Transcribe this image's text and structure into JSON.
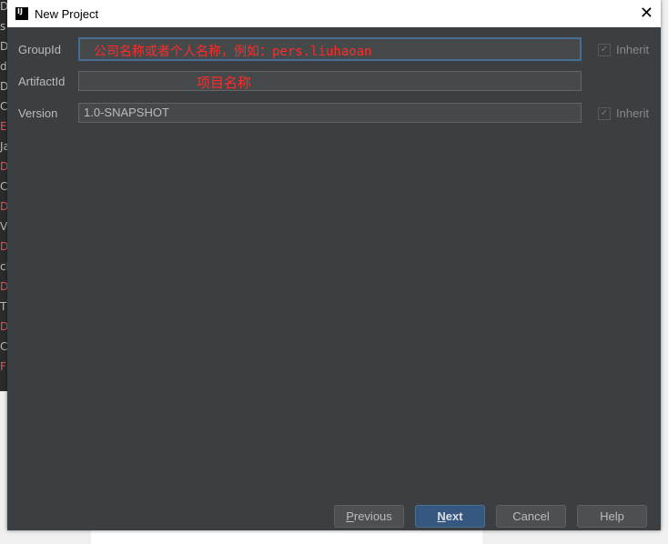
{
  "background": {
    "letters": [
      "D",
      "s",
      "D",
      "d",
      "D",
      "C",
      "E",
      "Ja",
      "D",
      "C",
      "D",
      "V",
      "D",
      "cl",
      "D",
      "T",
      "D",
      "C",
      "F"
    ]
  },
  "dialog": {
    "title": "New Project",
    "fields": [
      {
        "label": "GroupId",
        "value": "",
        "annotation": "公司名称或者个人名称，例如：pers.liuhaoan",
        "inherit": "Inherit",
        "inherit_checked": true
      },
      {
        "label": "ArtifactId",
        "value": "",
        "annotation": "项目名称"
      },
      {
        "label": "Version",
        "value": "1.0-SNAPSHOT",
        "inherit": "Inherit",
        "inherit_checked": true
      }
    ],
    "buttons": {
      "previous": "Previous",
      "next": "Next",
      "cancel": "Cancel",
      "help": "Help"
    },
    "annotation_color": "#ff2b2b"
  }
}
